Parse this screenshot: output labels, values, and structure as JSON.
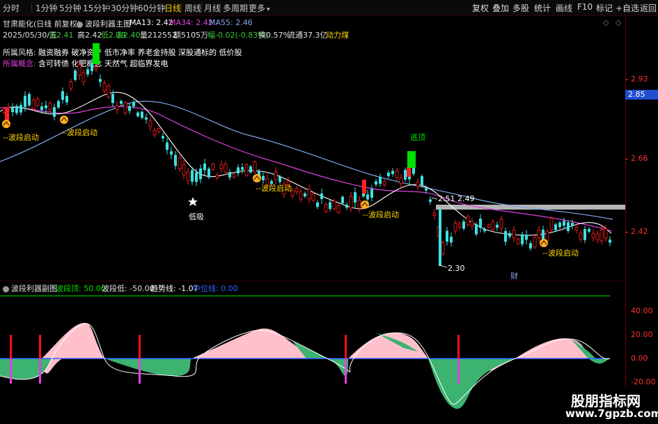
{
  "toolbar": {
    "periods": [
      "分时",
      "1分钟",
      "5分钟",
      "15分钟",
      "30分钟",
      "60分钟",
      "日线",
      "周线",
      "月线",
      "多周期",
      "更多"
    ],
    "active_period": "日线",
    "more_arrow": "▾",
    "right_buttons": [
      "复权",
      "叠加",
      "多股",
      "统计",
      "画线",
      "F10",
      "标记",
      "+自选",
      "返回"
    ]
  },
  "header": {
    "stock": "甘肃能化(日线 前复权)",
    "indicator": "波段利器主图",
    "ma13": "MA13: 2.42",
    "ma34": "MA34: 2.42",
    "ma55": "MA55: 2.46",
    "date": "2025/05/30/五",
    "open": "开2.41",
    "high": "高2.42",
    "low": "低2.39",
    "close": "收2.40",
    "volume": "量212552",
    "amount": "额5105万",
    "change": "幅-0.02(-0.83%)",
    "turnover": "换0.57%",
    "float": "流通37.3亿",
    "concept_tag": "动力煤"
  },
  "info": {
    "style_label": "所属风格:",
    "style_value": "融资融券 破净资产 低市净率 养老金持股 深股通标的 低价股",
    "concept_label": "所属概念:",
    "concept_value": "含可转债 化肥概念 天然气 超临界发电"
  },
  "annotations": {
    "start": "--波段启动",
    "escape": "逃顶",
    "lowbuy": "低吸",
    "wealth": "财",
    "p251": "2.51",
    "p249": "2.49",
    "p230": "2.30"
  },
  "price_axis": {
    "labels": [
      "2.93",
      "2.85",
      "2.66",
      "2.42"
    ],
    "current": "2.85"
  },
  "osc_header": {
    "name": "波段利器副图",
    "top": "波段顶: 50.00",
    "low": "波段低: -50.00",
    "trend": "趋势线: -1.07",
    "mid": "中位线: 0.00"
  },
  "osc_axis": {
    "labels": [
      "40.00",
      "20.00",
      "0.00",
      "-20.00"
    ]
  },
  "watermark": {
    "line1": "股朋指标网",
    "line2": "www.7gpzb.com"
  },
  "colors": {
    "up": "#ff2020",
    "down": "#40e0e0",
    "ma13": "#ffffff",
    "ma34": "#e040e0",
    "ma55": "#7fa8e8",
    "pink": "#ffc0cb",
    "green": "#3cb371",
    "accent": "#ffd700"
  }
}
